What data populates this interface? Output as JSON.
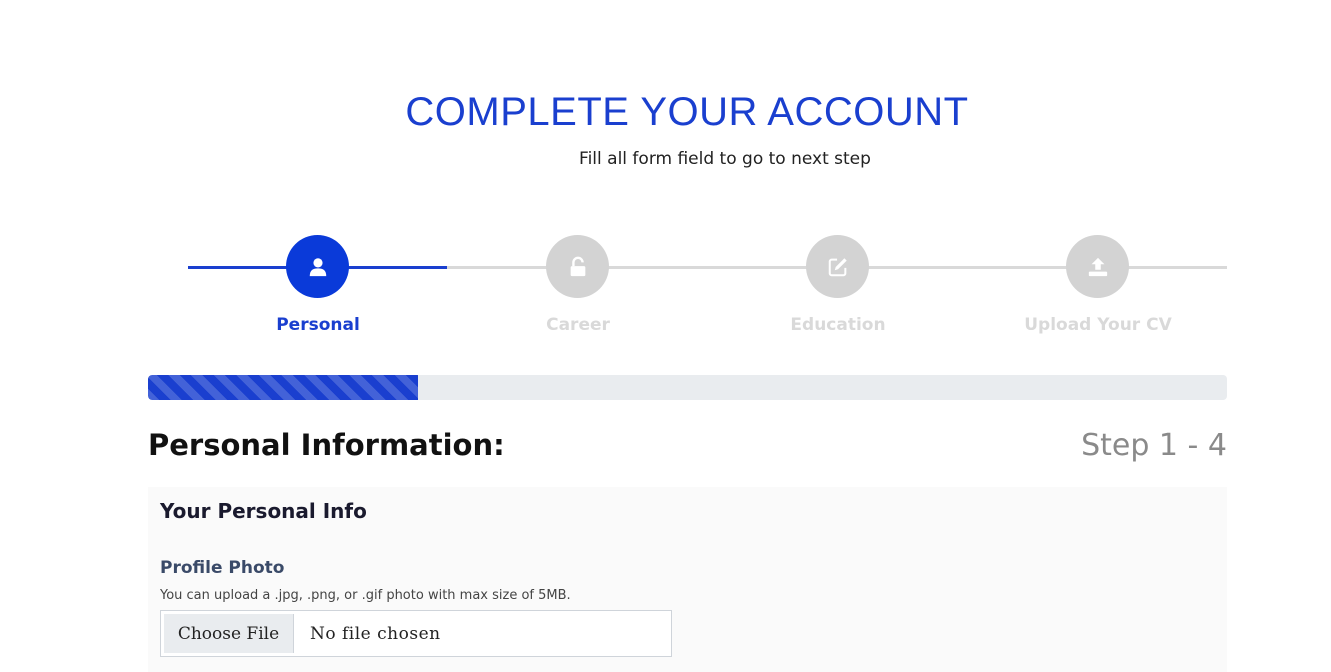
{
  "header": {
    "title": "COMPLETE YOUR ACCOUNT",
    "subtitle": "Fill all form field to go to next step"
  },
  "stepper": {
    "active_color": "#1a3fcf",
    "inactive_color": "#d3d3d3",
    "steps": [
      {
        "label": "Personal",
        "icon": "user-icon",
        "active": true
      },
      {
        "label": "Career",
        "icon": "unlock-icon",
        "active": false
      },
      {
        "label": "Education",
        "icon": "edit-icon",
        "active": false
      },
      {
        "label": "Upload Your CV",
        "icon": "upload-icon",
        "active": false
      }
    ]
  },
  "progress": {
    "percent": 25
  },
  "section": {
    "title": "Personal Information:",
    "step_count": "Step 1 - 4"
  },
  "card": {
    "title": "Your Personal Info",
    "profile_photo": {
      "label": "Profile Photo",
      "help": "You can upload a .jpg, .png, or .gif photo with max size of 5MB.",
      "button_label": "Choose File",
      "status": "No file chosen"
    }
  }
}
